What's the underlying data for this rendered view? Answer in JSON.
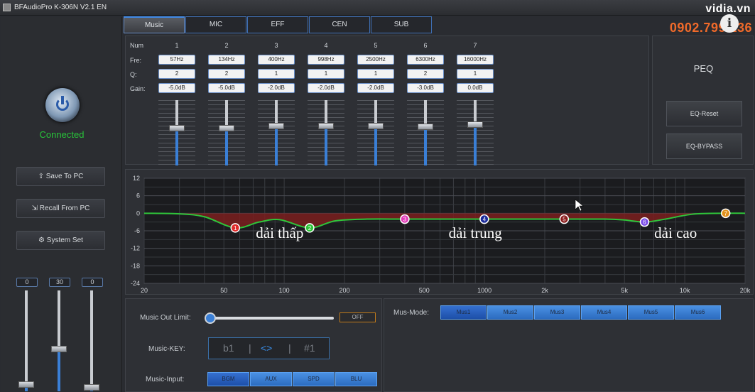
{
  "window": {
    "title": "BFAudioPro K-306N V2.1 EN"
  },
  "watermark": {
    "brand": "vidia.vn",
    "phone": "0902.799.136",
    "info_glyph": "i"
  },
  "left": {
    "status": "Connected",
    "buttons": [
      {
        "icon": "upload-icon",
        "glyph": "⇪",
        "label": "Save To PC"
      },
      {
        "icon": "recall-icon",
        "glyph": "⇲",
        "label": "Recall From PC"
      },
      {
        "icon": "gear-icon",
        "glyph": "⚙",
        "label": "System Set"
      }
    ],
    "faders": [
      {
        "value": "0",
        "level": 0.03
      },
      {
        "value": "30",
        "level": 0.41
      },
      {
        "value": "0",
        "level": 0.0
      }
    ]
  },
  "tabs": [
    "Music",
    "MIC",
    "EFF",
    "CEN",
    "SUB"
  ],
  "active_tab": "Music",
  "eq": {
    "row_labels": {
      "num": "Num",
      "fre": "Fre:",
      "q": "Q:",
      "gain": "Gain:"
    },
    "bands": [
      {
        "num": "1",
        "fre": "57Hz",
        "q": "2",
        "gain": "-5.0dB",
        "gain_db": -5.0
      },
      {
        "num": "2",
        "fre": "134Hz",
        "q": "2",
        "gain": "-5.0dB",
        "gain_db": -5.0
      },
      {
        "num": "3",
        "fre": "400Hz",
        "q": "1",
        "gain": "-2.0dB",
        "gain_db": -2.0
      },
      {
        "num": "4",
        "fre": "998Hz",
        "q": "1",
        "gain": "-2.0dB",
        "gain_db": -2.0
      },
      {
        "num": "5",
        "fre": "2500Hz",
        "q": "1",
        "gain": "-2.0dB",
        "gain_db": -2.0
      },
      {
        "num": "6",
        "fre": "6300Hz",
        "q": "2",
        "gain": "-3.0dB",
        "gain_db": -3.0
      },
      {
        "num": "7",
        "fre": "16000Hz",
        "q": "1",
        "gain": "0.0dB",
        "gain_db": 0.0
      }
    ]
  },
  "peq": {
    "title": "PEQ",
    "reset": "EQ-Reset",
    "bypass": "EQ-BYPASS"
  },
  "chart_data": {
    "type": "line",
    "xscale": "log",
    "xlim": [
      20,
      20000
    ],
    "ylim": [
      -24,
      12
    ],
    "x_ticks": [
      "20",
      "50",
      "100",
      "200",
      "500",
      "1000",
      "2k",
      "5k",
      "10k",
      "20k"
    ],
    "y_ticks": [
      "12",
      "6",
      "0",
      "-6",
      "-12",
      "-18",
      "-24"
    ],
    "grid": true,
    "series": [
      {
        "name": "",
        "color": "#2fc43a",
        "points": [
          [
            20,
            0
          ],
          [
            30,
            -0.2
          ],
          [
            40,
            -1.2
          ],
          [
            57,
            -5
          ],
          [
            75,
            -3
          ],
          [
            95,
            -2.2
          ],
          [
            134,
            -5
          ],
          [
            180,
            -2.6
          ],
          [
            260,
            -2
          ],
          [
            400,
            -2
          ],
          [
            700,
            -2
          ],
          [
            998,
            -2
          ],
          [
            1500,
            -2
          ],
          [
            2500,
            -2
          ],
          [
            4000,
            -2
          ],
          [
            5000,
            -2.3
          ],
          [
            6300,
            -3
          ],
          [
            8000,
            -2
          ],
          [
            11000,
            -0.3
          ],
          [
            16000,
            0
          ],
          [
            20000,
            0
          ]
        ]
      }
    ],
    "nodes": [
      {
        "label": "1",
        "freq": 57,
        "gain": -5.0,
        "color": "#e02a2a"
      },
      {
        "label": "2",
        "freq": 134,
        "gain": -5.0,
        "color": "#2fc43a"
      },
      {
        "label": "3",
        "freq": 400,
        "gain": -2.0,
        "color": "#e23bb8"
      },
      {
        "label": "4",
        "freq": 998,
        "gain": -2.0,
        "color": "#1a2a9a"
      },
      {
        "label": "5",
        "freq": 2500,
        "gain": -2.0,
        "color": "#8a1a1a"
      },
      {
        "label": "6",
        "freq": 6300,
        "gain": -3.0,
        "color": "#7a4be8"
      },
      {
        "label": "7",
        "freq": 16000,
        "gain": 0.0,
        "color": "#e0901a"
      }
    ],
    "annotations": [
      {
        "text": "dải thấp",
        "freq": 95,
        "gain": -7
      },
      {
        "text": "dải trung",
        "freq": 900,
        "gain": -7
      },
      {
        "text": "dải cao",
        "freq": 9000,
        "gain": -7
      }
    ]
  },
  "music": {
    "out_limit_label": "Music Out Limit:",
    "out_limit_level": 0.0,
    "off_label": "OFF",
    "key_label": "Music-KEY:",
    "key_left": "b1",
    "key_sep1": "|",
    "key_arrows": "<>",
    "key_sep2": "|",
    "key_right": "#1",
    "input_label": "Music-Input:",
    "inputs": [
      "BGM",
      "AUX",
      "SPD",
      "BLU"
    ],
    "selected_input": "BGM",
    "mode_label": "Mus-Mode:",
    "modes": [
      "Mus1",
      "Mus2",
      "Mus3",
      "Mus4",
      "Mus5",
      "Mus6"
    ],
    "selected_mode": "Mus1"
  }
}
